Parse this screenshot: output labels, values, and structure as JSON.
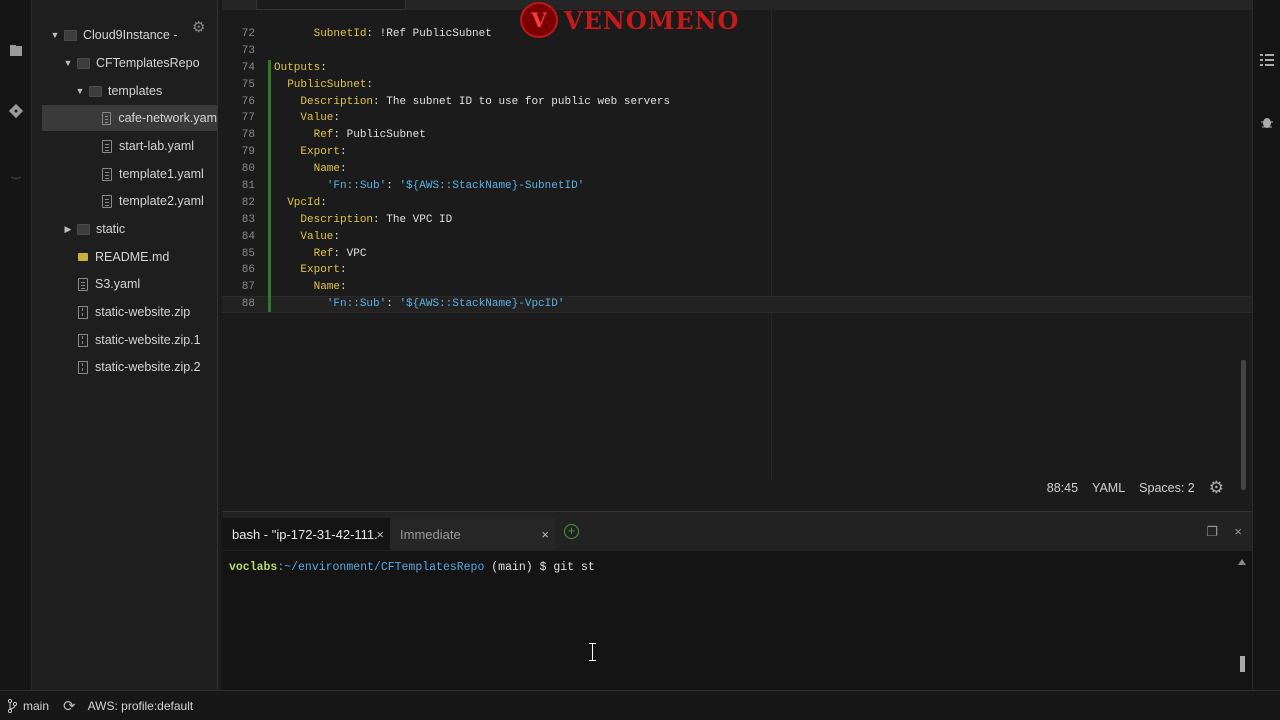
{
  "tree": {
    "items": [
      {
        "label": "Cloud9Instance -",
        "kind": "folder",
        "expanded": true
      },
      {
        "label": "CFTemplatesRepo",
        "kind": "folder",
        "expanded": true
      },
      {
        "label": "templates",
        "kind": "folder",
        "expanded": true
      },
      {
        "label": "cafe-network.yam",
        "kind": "file"
      },
      {
        "label": "start-lab.yaml",
        "kind": "file"
      },
      {
        "label": "template1.yaml",
        "kind": "file"
      },
      {
        "label": "template2.yaml",
        "kind": "file"
      },
      {
        "label": "static",
        "kind": "folder",
        "expanded": false
      },
      {
        "label": "README.md",
        "kind": "md"
      },
      {
        "label": "S3.yaml",
        "kind": "file"
      },
      {
        "label": "static-website.zip",
        "kind": "zip"
      },
      {
        "label": "static-website.zip.1",
        "kind": "zip"
      },
      {
        "label": "static-website.zip.2",
        "kind": "zip"
      }
    ]
  },
  "editor": {
    "line_numbers": [
      "72",
      "73",
      "74",
      "75",
      "76",
      "77",
      "78",
      "79",
      "80",
      "81",
      "82",
      "83",
      "84",
      "85",
      "86",
      "87",
      "88"
    ],
    "lines": [
      {
        "indent": "      ",
        "key": "SubnetId",
        "rest": " !Ref PublicSubnet"
      },
      {
        "indent": "",
        "key": "",
        "rest": ""
      },
      {
        "indent": "",
        "key": "Outputs",
        "rest": ""
      },
      {
        "indent": "  ",
        "key": "PublicSubnet",
        "rest": ""
      },
      {
        "indent": "    ",
        "key": "Description",
        "rest": " The subnet ID to use for public web servers"
      },
      {
        "indent": "    ",
        "key": "Value",
        "rest": ""
      },
      {
        "indent": "      ",
        "key": "Ref",
        "rest": " PublicSubnet"
      },
      {
        "indent": "    ",
        "key": "Export",
        "rest": ""
      },
      {
        "indent": "      ",
        "key": "Name",
        "rest": ""
      },
      {
        "indent": "        ",
        "str1": "'Fn::Sub'",
        "str2": "'${AWS::StackName}-SubnetID'"
      },
      {
        "indent": "  ",
        "key": "VpcId",
        "rest": ""
      },
      {
        "indent": "    ",
        "key": "Description",
        "rest": " The VPC ID"
      },
      {
        "indent": "    ",
        "key": "Value",
        "rest": ""
      },
      {
        "indent": "      ",
        "key": "Ref",
        "rest": " VPC"
      },
      {
        "indent": "    ",
        "key": "Export",
        "rest": ""
      },
      {
        "indent": "      ",
        "key": "Name",
        "rest": ""
      },
      {
        "indent": "        ",
        "str1": "'Fn::Sub'",
        "str2": "'${AWS::StackName}-VpcID'"
      }
    ],
    "status": {
      "cursor": "88:45",
      "mode": "YAML",
      "spaces": "Spaces: 2"
    }
  },
  "logo": {
    "text": "VENOMENO",
    "initial": "V"
  },
  "terminal": {
    "tabs": [
      {
        "label": "bash - \"ip-172-31-42-111.",
        "active": true
      },
      {
        "label": "Immediate",
        "active": false
      }
    ],
    "prompt_user": "voclabs",
    "prompt_path": ":~/environment/CFTemplatesRepo",
    "prompt_branch": " (main) $ ",
    "command": "git st"
  },
  "statusbar": {
    "branch": "main",
    "aws_profile": "AWS: profile:default"
  }
}
